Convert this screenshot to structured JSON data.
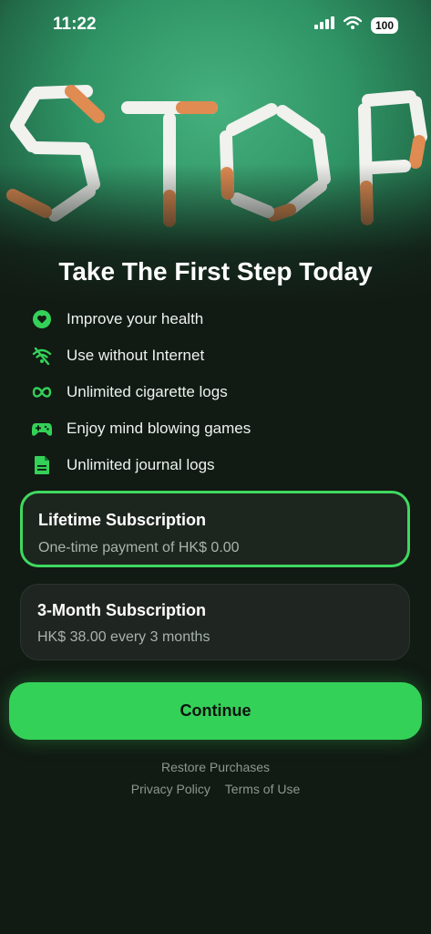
{
  "status_bar": {
    "time": "11:22",
    "battery": "100"
  },
  "hero": {
    "image_text": "STOP"
  },
  "title": "Take The First Step Today",
  "features": [
    {
      "icon": "heart-icon",
      "label": "Improve your health"
    },
    {
      "icon": "wifi-off-icon",
      "label": "Use without Internet"
    },
    {
      "icon": "infinity-icon",
      "label": "Unlimited cigarette logs"
    },
    {
      "icon": "gamepad-icon",
      "label": "Enjoy mind blowing games"
    },
    {
      "icon": "document-icon",
      "label": "Unlimited journal logs"
    }
  ],
  "plans": [
    {
      "name": "Lifetime Subscription",
      "price": "One-time payment of HK$ 0.00",
      "selected": true
    },
    {
      "name": "3-Month Subscription",
      "price": "HK$ 38.00 every 3 months",
      "selected": false
    }
  ],
  "continue_label": "Continue",
  "footer": {
    "restore": "Restore Purchases",
    "privacy": "Privacy Policy",
    "terms": "Terms of Use"
  },
  "colors": {
    "accent": "#34d158",
    "background": "#111a13",
    "hero": "#2f9465"
  }
}
